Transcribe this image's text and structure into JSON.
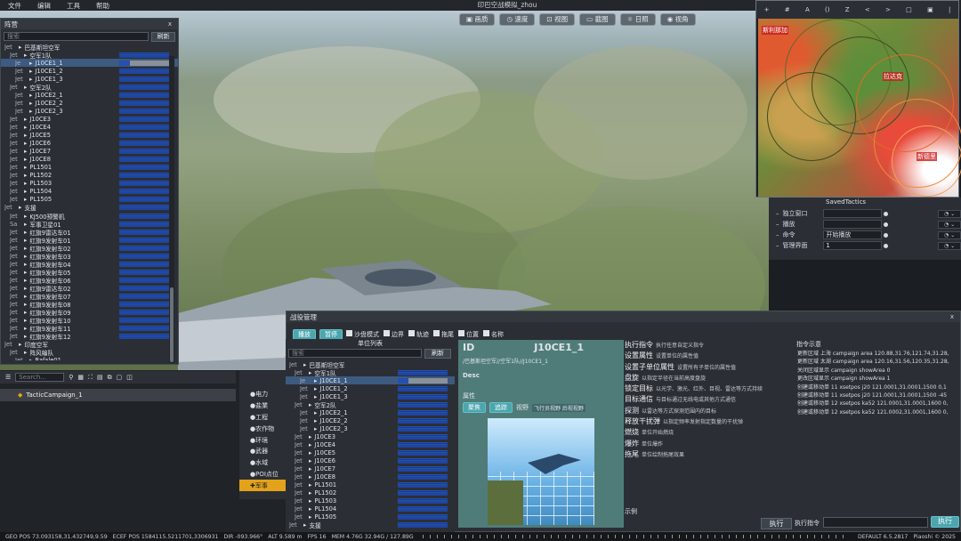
{
  "menubar": {
    "items": [
      "文件",
      "编辑",
      "工具",
      "帮助"
    ],
    "window_title": "印巴空战模拟_zhou"
  },
  "top_toolbar": [
    "画质",
    "速度",
    "视图",
    "截图",
    "日照",
    "视角"
  ],
  "formation_panel": {
    "title": "阵营",
    "close": "x",
    "search_placeholder": "搜索",
    "refresh": "刷新",
    "rows": [
      {
        "pre": "Jet",
        "indent": 0,
        "label": "巴基斯坦空军",
        "bar": 0
      },
      {
        "pre": "Jet",
        "indent": 1,
        "label": "空军1队",
        "bar": 1
      },
      {
        "pre": "Je",
        "indent": 2,
        "label": "J10CE1_1",
        "bar": 1,
        "sel": true
      },
      {
        "pre": "Jet",
        "indent": 2,
        "label": "J10CE1_2",
        "bar": 1
      },
      {
        "pre": "Jet",
        "indent": 2,
        "label": "J10CE1_3",
        "bar": 1
      },
      {
        "pre": "Jet",
        "indent": 1,
        "label": "空军2队",
        "bar": 1
      },
      {
        "pre": "Jet",
        "indent": 2,
        "label": "J10CE2_1",
        "bar": 1
      },
      {
        "pre": "Jet",
        "indent": 2,
        "label": "J10CE2_2",
        "bar": 1
      },
      {
        "pre": "Jet",
        "indent": 2,
        "label": "J10CE2_3",
        "bar": 1
      },
      {
        "pre": "Jet",
        "indent": 1,
        "label": "J10CE3",
        "bar": 1
      },
      {
        "pre": "Jet",
        "indent": 1,
        "label": "J10CE4",
        "bar": 1
      },
      {
        "pre": "Jet",
        "indent": 1,
        "label": "J10CE5",
        "bar": 1
      },
      {
        "pre": "Jet",
        "indent": 1,
        "label": "J10CE6",
        "bar": 1
      },
      {
        "pre": "Jet",
        "indent": 1,
        "label": "J10CE7",
        "bar": 1
      },
      {
        "pre": "Jet",
        "indent": 1,
        "label": "J10CE8",
        "bar": 1
      },
      {
        "pre": "Jet",
        "indent": 1,
        "label": "PL1501",
        "bar": 1
      },
      {
        "pre": "Jet",
        "indent": 1,
        "label": "PL1502",
        "bar": 1
      },
      {
        "pre": "Jet",
        "indent": 1,
        "label": "PL1503",
        "bar": 1
      },
      {
        "pre": "Jet",
        "indent": 1,
        "label": "PL1504",
        "bar": 1
      },
      {
        "pre": "Jet",
        "indent": 1,
        "label": "PL1505",
        "bar": 1
      },
      {
        "pre": "Jet",
        "indent": 0,
        "label": "支援",
        "bar": 1
      },
      {
        "pre": "Jet",
        "indent": 1,
        "label": "KJ500预警机",
        "bar": 1
      },
      {
        "pre": "Sa",
        "indent": 1,
        "label": "军事卫星01",
        "bar": 1
      },
      {
        "pre": "Jet",
        "indent": 1,
        "label": "红旗9雷达车01",
        "bar": 1
      },
      {
        "pre": "Jet",
        "indent": 1,
        "label": "红旗9发射车01",
        "bar": 1
      },
      {
        "pre": "Jet",
        "indent": 1,
        "label": "红旗9发射车02",
        "bar": 1
      },
      {
        "pre": "Jet",
        "indent": 1,
        "label": "红旗9发射车03",
        "bar": 1
      },
      {
        "pre": "Jet",
        "indent": 1,
        "label": "红旗9发射车04",
        "bar": 1
      },
      {
        "pre": "Jet",
        "indent": 1,
        "label": "红旗9发射车05",
        "bar": 1
      },
      {
        "pre": "Jet",
        "indent": 1,
        "label": "红旗9发射车06",
        "bar": 1
      },
      {
        "pre": "Jet",
        "indent": 1,
        "label": "红旗9雷达车02",
        "bar": 1
      },
      {
        "pre": "Jet",
        "indent": 1,
        "label": "红旗9发射车07",
        "bar": 1
      },
      {
        "pre": "Jet",
        "indent": 1,
        "label": "红旗9发射车08",
        "bar": 1
      },
      {
        "pre": "Jet",
        "indent": 1,
        "label": "红旗9发射车09",
        "bar": 1
      },
      {
        "pre": "Jet",
        "indent": 1,
        "label": "红旗9发射车10",
        "bar": 1
      },
      {
        "pre": "Jet",
        "indent": 1,
        "label": "红旗9发射车11",
        "bar": 1
      },
      {
        "pre": "Jet",
        "indent": 1,
        "label": "红旗9发射车12",
        "bar": 1
      },
      {
        "pre": "Jet",
        "indent": 0,
        "label": "印度空军",
        "bar": 0
      },
      {
        "pre": "Jet",
        "indent": 1,
        "label": "阵风编队",
        "bar": 0
      },
      {
        "pre": "Jet",
        "indent": 2,
        "label": "Rafale01",
        "bar": 0
      }
    ]
  },
  "outliner": {
    "search": "Search..."
  },
  "campaign_item": "TacticCampaign_1",
  "categories": [
    "电力",
    "盐業",
    "工程",
    "农作物",
    "环境",
    "武器",
    "水域",
    "POI点位",
    "军事"
  ],
  "minimap": {
    "tools": [
      "+",
      "#",
      "A",
      "()",
      "Z",
      "<",
      ">",
      "□",
      "▣",
      "|"
    ],
    "labels": [
      "斯利那加",
      "拉达克",
      "新德里"
    ]
  },
  "props": {
    "rows": [
      {
        "k": "独立窗口",
        "v": ""
      },
      {
        "k": "播放",
        "v": ""
      },
      {
        "k": "命令",
        "v": "开始播放"
      },
      {
        "k": "管理界面",
        "v": "1"
      }
    ],
    "top_value": "SavedTactics"
  },
  "battle": {
    "title": "战役管理",
    "close": "x",
    "play": "播放",
    "pause": "暂停",
    "checks": [
      "沙盘模式",
      "边界",
      "轨迹",
      "拖尾",
      "位置",
      "名称"
    ],
    "unit_list_title": "单位列表",
    "search": "搜索",
    "refresh": "刷新",
    "units": [
      {
        "pre": "Jet",
        "indent": 0,
        "label": "巴基斯坦空军",
        "bar": 0
      },
      {
        "pre": "Jet",
        "indent": 1,
        "label": "空军1队",
        "bar": 1
      },
      {
        "pre": "Je",
        "indent": 2,
        "label": "J10CE1_1",
        "bar": 1,
        "sel": true
      },
      {
        "pre": "Jet",
        "indent": 2,
        "label": "J10CE1_2",
        "bar": 1
      },
      {
        "pre": "Jet",
        "indent": 2,
        "label": "J10CE1_3",
        "bar": 1
      },
      {
        "pre": "Jet",
        "indent": 1,
        "label": "空军2队",
        "bar": 1
      },
      {
        "pre": "Jet",
        "indent": 2,
        "label": "J10CE2_1",
        "bar": 1
      },
      {
        "pre": "Jet",
        "indent": 2,
        "label": "J10CE2_2",
        "bar": 1
      },
      {
        "pre": "Jet",
        "indent": 2,
        "label": "J10CE2_3",
        "bar": 1
      },
      {
        "pre": "Jet",
        "indent": 1,
        "label": "J10CE3",
        "bar": 1
      },
      {
        "pre": "Jet",
        "indent": 1,
        "label": "J10CE4",
        "bar": 1
      },
      {
        "pre": "Jet",
        "indent": 1,
        "label": "J10CE5",
        "bar": 1
      },
      {
        "pre": "Jet",
        "indent": 1,
        "label": "J10CE6",
        "bar": 1
      },
      {
        "pre": "Jet",
        "indent": 1,
        "label": "J10CE7",
        "bar": 1
      },
      {
        "pre": "Jet",
        "indent": 1,
        "label": "J10CE8",
        "bar": 1
      },
      {
        "pre": "Jet",
        "indent": 1,
        "label": "PL1501",
        "bar": 1
      },
      {
        "pre": "Jet",
        "indent": 1,
        "label": "PL1502",
        "bar": 1
      },
      {
        "pre": "Jet",
        "indent": 1,
        "label": "PL1503",
        "bar": 1
      },
      {
        "pre": "Jet",
        "indent": 1,
        "label": "PL1504",
        "bar": 1
      },
      {
        "pre": "Jet",
        "indent": 1,
        "label": "PL1505",
        "bar": 1
      },
      {
        "pre": "Jet",
        "indent": 0,
        "label": "支援",
        "bar": 1
      }
    ],
    "detail": {
      "id_label": "ID",
      "id_value": "J10CE1_1",
      "path": "/巴基斯坦空军//空军1队//J10CE1_1",
      "desc": "Desc",
      "attr": "属性",
      "focus": "聚焦",
      "follow": "追踪",
      "view": "视野",
      "view_opts": "飞行员视野  后视视野"
    },
    "commands": [
      {
        "t": "执行指令",
        "d": "执行任意自定义指令"
      },
      {
        "t": "设置属性",
        "d": "设置单位的属性值"
      },
      {
        "t": "设置子单位属性",
        "d": "设置所有子单位的属性值"
      },
      {
        "t": "盘旋",
        "d": "以指定半径在当前高度盘旋"
      },
      {
        "t": "锁定目标",
        "d": "以光学、激光、红外、目视、雷达等方式持续"
      },
      {
        "t": "目标通信",
        "d": "与目标通过无线电或其他方式通信"
      },
      {
        "t": "探测",
        "d": "以雷达等方式探测范围内的目标"
      },
      {
        "t": "释放干扰弹",
        "d": "以指定频率发射指定数量的干扰弹"
      },
      {
        "t": "燃烧",
        "d": "单位开始燃烧"
      },
      {
        "t": "爆炸",
        "d": "单位爆炸"
      },
      {
        "t": "拖尾",
        "d": "单位绘制拖尾效果"
      }
    ],
    "example": "示例",
    "exec": "执行",
    "hints_title": "指令示意",
    "hints": [
      "更新区域 上海 campaign area 120.88,31.76,121.74,31.28,",
      "更新区域 太湖 campaign area 120.16,31.56,120.35,31.28,",
      "关闭区域显示 campaign showArea 0",
      "更改区域显示 campaign showArea 1",
      "创建或移动单 11 xsetpos j20 121.0001,31.0001,1500 0,1",
      "创建或移动单 11 xsetpos j20 121.0001,31.0001,1500 -45",
      "创建或移动单 12 xsetpos ka52 121.0001,31.0001,1600 0,",
      "创建或移动单 12 xsetpos ka52 121.0002,31.0001,1600 0,"
    ],
    "exec_cmd": "执行指令",
    "exec2": "执行"
  },
  "statusbar": {
    "geo": "GEO POS 73.093158,31.432749,9.59",
    "ecef": "ECEF POS 1584115.5211701,3306931",
    "dir": "DIR -093.966°",
    "alt": "ALT 9.589 m",
    "fps": "FPS 16",
    "mem": "MEM 4.76G 32.94G / 127.89G",
    "default": "DEFAULT 6.5.2817",
    "copyright": "Piaoshi © 2025"
  }
}
